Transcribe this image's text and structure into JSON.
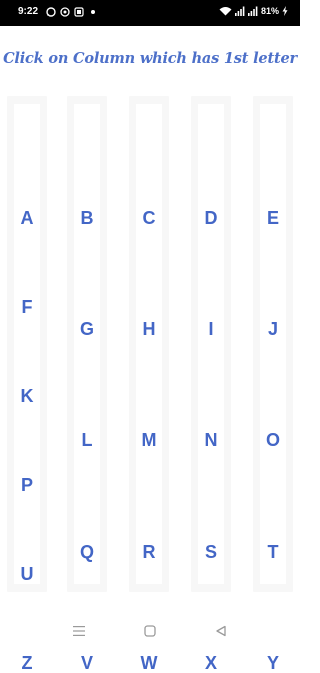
{
  "status_bar": {
    "time": "9:22",
    "battery": "81%",
    "icons": [
      "whatsapp-icon",
      "app-icon",
      "gallery-icon",
      "notification-dot",
      "wifi-icon",
      "signal-icon",
      "signal-icon",
      "charging-icon"
    ]
  },
  "header": {
    "title": "Click on Column which has 1st letter"
  },
  "columns": [
    {
      "letters": [
        "A",
        "F",
        "K",
        "P",
        "U",
        "Z"
      ]
    },
    {
      "letters": [
        "B",
        "G",
        "L",
        "Q",
        "V"
      ]
    },
    {
      "letters": [
        "C",
        "H",
        "M",
        "R",
        "W"
      ]
    },
    {
      "letters": [
        "D",
        "I",
        "N",
        "S",
        "X"
      ]
    },
    {
      "letters": [
        "E",
        "J",
        "O",
        "T",
        "Y"
      ]
    }
  ],
  "nav_bar": {
    "buttons": [
      "menu-icon",
      "home-icon",
      "back-icon"
    ]
  },
  "colors": {
    "accent": "#4366c6",
    "title": "#4d70c9",
    "column_bg": "#f7f7f7"
  }
}
